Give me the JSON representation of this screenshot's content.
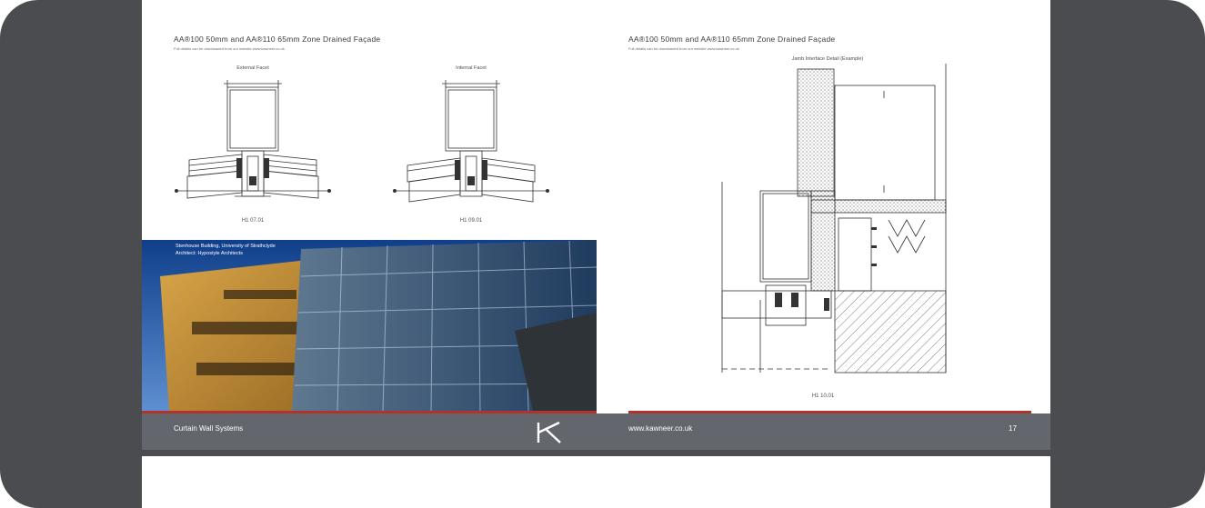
{
  "left_page": {
    "title": "AA®100 50mm and AA®110 65mm Zone Drained Façade",
    "subtitle": "Full details can be downloaded from our website www.kawneer.co.uk",
    "drawings": [
      {
        "caption": "External Facet",
        "ref": "H1 07.01"
      },
      {
        "caption": "Internal Facet",
        "ref": "H1 09.01"
      }
    ],
    "photo": {
      "caption_line1": "Stenhouse Building, University of Strathclyde",
      "caption_line2": "Architect: Hypostyle Architects"
    },
    "footer": "Curtain Wall Systems"
  },
  "right_page": {
    "title": "AA®100 50mm and AA®110 65mm Zone Drained Façade",
    "subtitle": "Full details can be downloaded from our website www.kawneer.co.uk",
    "drawing_caption": "Jamb Interface Detail (Example)",
    "drawing_ref": "H1 10.01",
    "footer_url": "www.kawneer.co.uk",
    "page_number": "17"
  },
  "logo": {
    "icon": "kawneer-k-logo-icon"
  },
  "colors": {
    "footer": "#63676d",
    "accent_red": "#b2332c",
    "frame": "#4a4c50"
  }
}
